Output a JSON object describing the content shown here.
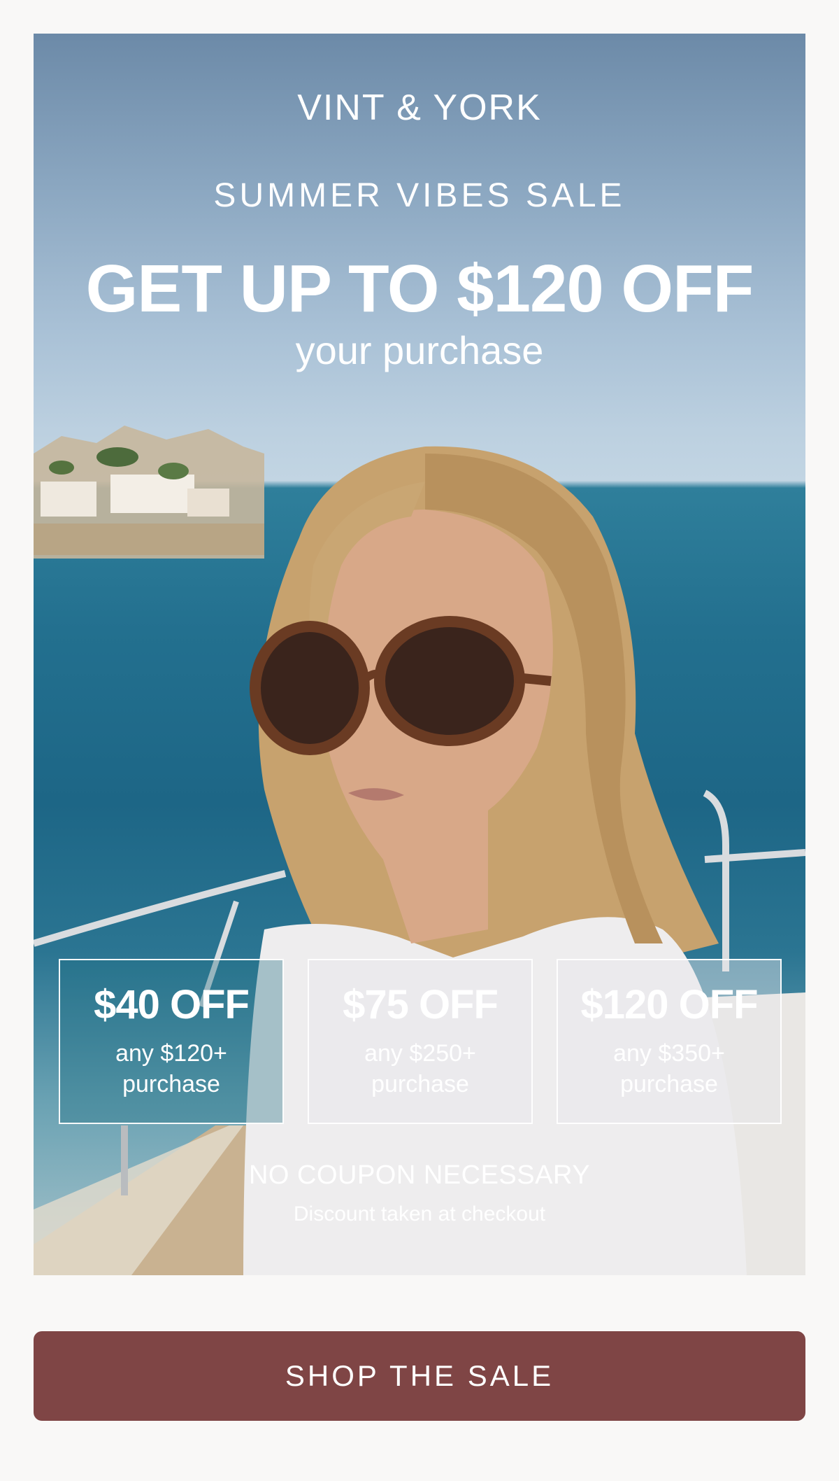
{
  "brand": {
    "name": "VINT & YORK"
  },
  "hero": {
    "eyebrow": "SUMMER VIBES SALE",
    "headline": "GET UP TO $120 OFF",
    "subline": "your purchase"
  },
  "offers": [
    {
      "amount": "$40 OFF",
      "condition": "any $120+ purchase"
    },
    {
      "amount": "$75 OFF",
      "condition": "any $250+ purchase"
    },
    {
      "amount": "$120 OFF",
      "condition": "any $350+ purchase"
    }
  ],
  "note": {
    "primary": "NO COUPON NECESSARY",
    "secondary": "Discount taken at checkout"
  },
  "cta": {
    "label": "SHOP THE SALE"
  },
  "colors": {
    "cta_background": "#7f4545",
    "page_background": "#f9f8f7",
    "text": "#ffffff"
  }
}
